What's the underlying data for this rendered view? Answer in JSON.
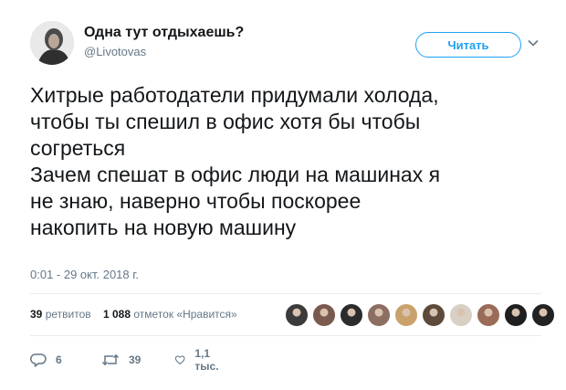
{
  "author": {
    "name": "Одна тут отдыхаешь?",
    "handle": "@Livotovas"
  },
  "follow_button": {
    "label": "Читать"
  },
  "icons": {
    "caret": "chevron-down-icon",
    "reply": "reply-icon",
    "retweet": "retweet-icon",
    "like": "heart-icon"
  },
  "tweet": {
    "lines": [
      "Хитрые работодатели придумали холода,",
      "чтобы ты спешил в офис хотя бы чтобы",
      "согреться",
      "Зачем спешат в офис люди на машинах я",
      "не знаю, наверно чтобы поскорее",
      "накопить на новую машину"
    ],
    "timestamp": "0:01 - 29 окт. 2018 г."
  },
  "stats": {
    "retweets_count": "39",
    "retweets_label": "ретвитов",
    "likes_count": "1 088",
    "likes_label": "отметок «Нравится»"
  },
  "likers_colors": [
    "#3b3b3b",
    "#7a5a4e",
    "#2c2c2c",
    "#8d6e63",
    "#c9a26b",
    "#5d4a3a",
    "#d8d0c4",
    "#9a6b58",
    "#1f1f1f",
    "#222222"
  ],
  "actions": {
    "reply_count": "6",
    "retweet_count": "39",
    "like_count": "1,1 тыс."
  },
  "colors": {
    "accent": "#1da1f2",
    "text": "#14171a",
    "muted": "#657786",
    "divider": "#e6ecf0"
  }
}
